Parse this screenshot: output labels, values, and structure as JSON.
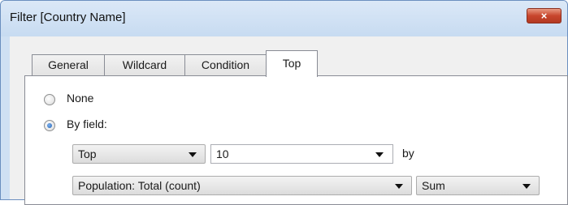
{
  "window": {
    "title": "Filter [Country Name]",
    "close_label": "×"
  },
  "tabs": [
    {
      "label": "General"
    },
    {
      "label": "Wildcard"
    },
    {
      "label": "Condition"
    },
    {
      "label": "Top",
      "active": true
    }
  ],
  "options": {
    "none_label": "None",
    "by_field_label": "By field:",
    "selected": "By field:"
  },
  "by_field": {
    "direction": "Top",
    "count": "10",
    "by_label": "by",
    "field": "Population: Total (count)",
    "aggregation": "Sum"
  },
  "colors": {
    "title_bar": "#cfe0f3",
    "close_button": "#c8452c",
    "tab_border": "#898c95"
  }
}
